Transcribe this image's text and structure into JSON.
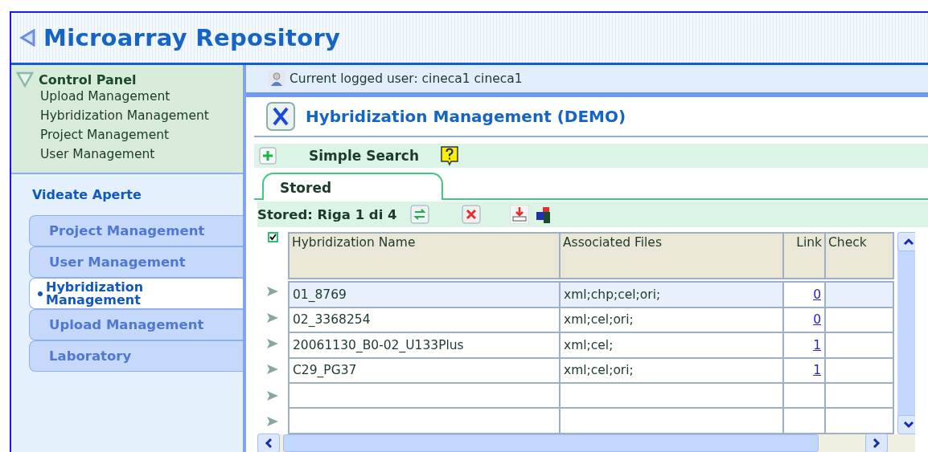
{
  "app": {
    "title": "Microarray Repository"
  },
  "control_panel": {
    "title": "Control Panel",
    "expanded": true,
    "items": [
      "Upload Management",
      "Hybridization Management",
      "Project Management",
      "User Management"
    ]
  },
  "open_views": {
    "title": "Videate Aperte",
    "items": [
      {
        "label": "Project Management",
        "selected": false
      },
      {
        "label": "User Management",
        "selected": false
      },
      {
        "label": "Hybridization Management",
        "selected": true
      },
      {
        "label": "Upload Management",
        "selected": false
      },
      {
        "label": "Laboratory",
        "selected": false
      }
    ]
  },
  "user_bar": {
    "text": "Current logged user: cineca1 cineca1"
  },
  "page_title": "Hybridization Management (DEMO)",
  "search": {
    "label": "Simple Search"
  },
  "tabs": [
    {
      "label": "Stored",
      "selected": true
    }
  ],
  "toolbar": {
    "status": "Stored: Riga 1 di 4"
  },
  "table": {
    "select_all": true,
    "columns": [
      "Hybridization Name",
      "Associated Files",
      "Link",
      "Check"
    ],
    "rows": [
      {
        "kind": "data",
        "name": "01_8769",
        "files": "xml;chp;cel;ori;",
        "link": "0",
        "selected": true
      },
      {
        "kind": "data",
        "name": "02_3368254",
        "files": "xml;cel;ori;",
        "link": "0",
        "selected": false
      },
      {
        "kind": "data",
        "name": "20061130_B0-02_U133Plus",
        "files": "xml;cel;",
        "link": "1",
        "selected": false
      },
      {
        "kind": "data",
        "name": "C29_PG37",
        "files": "xml;cel;ori;",
        "link": "1",
        "selected": false
      },
      {
        "kind": "empty",
        "selected": false
      },
      {
        "kind": "empty",
        "selected": false
      }
    ]
  }
}
